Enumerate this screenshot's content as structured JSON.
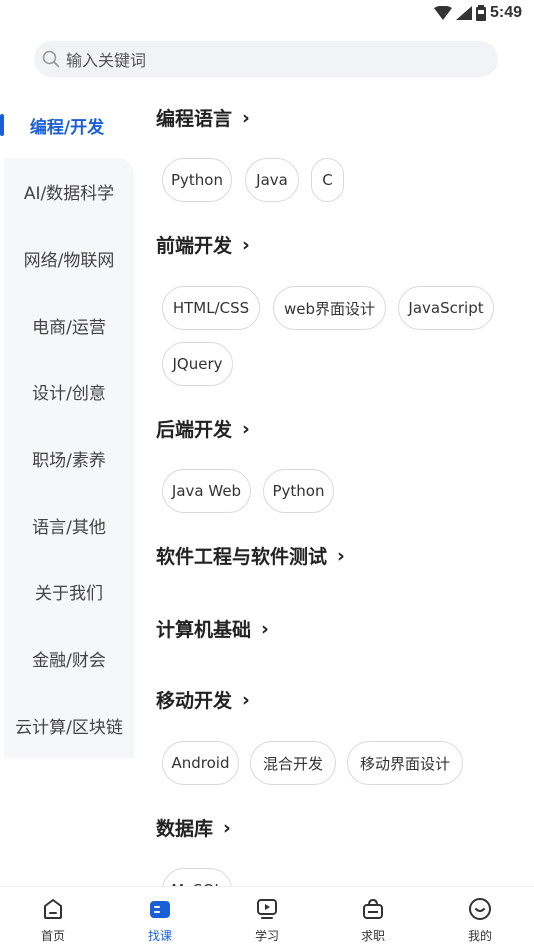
{
  "status": {
    "time": "5:49"
  },
  "search": {
    "placeholder": "输入关键词"
  },
  "sidebar": {
    "items": [
      {
        "label": "编程/开发"
      },
      {
        "label": "AI/数据科学"
      },
      {
        "label": "网络/物联网"
      },
      {
        "label": "电商/运营"
      },
      {
        "label": "设计/创意"
      },
      {
        "label": "职场/素养"
      },
      {
        "label": "语言/其他"
      },
      {
        "label": "关于我们"
      },
      {
        "label": "金融/财会"
      },
      {
        "label": "云计算/区块链"
      }
    ]
  },
  "sections": [
    {
      "title": "编程语言",
      "tags": [
        "Python",
        "Java",
        "C"
      ]
    },
    {
      "title": "前端开发",
      "tags": [
        "HTML/CSS",
        "web界面设计",
        "JavaScript",
        "JQuery"
      ]
    },
    {
      "title": "后端开发",
      "tags": [
        "Java Web",
        "Python"
      ]
    },
    {
      "title": "软件工程与软件测试",
      "tags": []
    },
    {
      "title": "计算机基础",
      "tags": []
    },
    {
      "title": "移动开发",
      "tags": [
        "Android",
        "混合开发",
        "移动界面设计"
      ]
    },
    {
      "title": "数据库",
      "tags": [
        "MySQL"
      ]
    }
  ],
  "chevron": "›",
  "bottom_nav": {
    "items": [
      {
        "label": "首页",
        "icon": "home-icon"
      },
      {
        "label": "找课",
        "icon": "find-course-icon"
      },
      {
        "label": "学习",
        "icon": "study-icon"
      },
      {
        "label": "求职",
        "icon": "job-icon"
      },
      {
        "label": "我的",
        "icon": "profile-icon"
      }
    ]
  },
  "colors": {
    "accent": "#1a5fd8",
    "sidebar_bg": "#f5f7f8",
    "search_bg": "#f2f3f5"
  }
}
